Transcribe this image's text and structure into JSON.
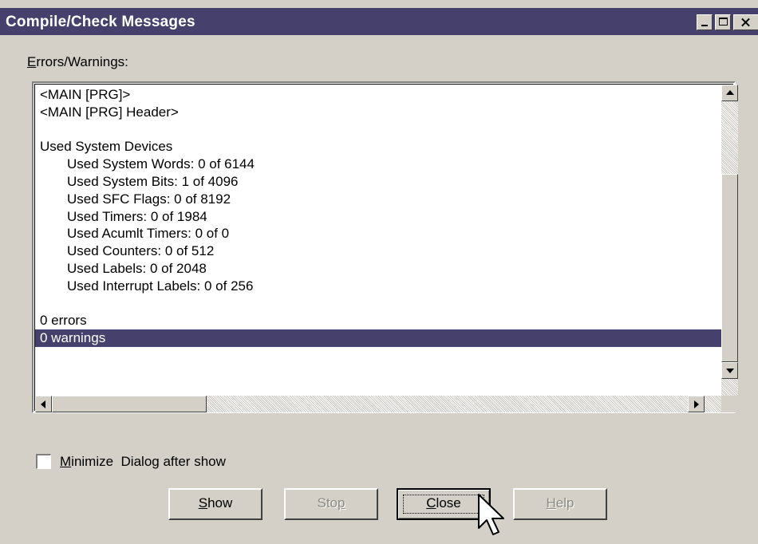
{
  "window": {
    "title": "Compile/Check Messages",
    "title_bar_color": "#46416c",
    "face_color": "#d4d0c8"
  },
  "group": {
    "label_accel": "E",
    "label_rest": "rrors/Warnings:"
  },
  "messages": {
    "lines": [
      "<MAIN [PRG]>",
      "<MAIN [PRG] Header>",
      "",
      "Used System Devices",
      "Used System Words: 0 of 6144",
      "Used System Bits: 1 of 4096",
      "Used SFC Flags: 0 of 8192",
      "Used Timers: 0 of 1984",
      "Used Acumlt Timers: 0 of 0",
      "Used Counters: 0 of 512",
      "Used Labels: 0 of 2048",
      "Used Interrupt Labels: 0 of 256",
      "",
      "0 errors",
      "0 warnings"
    ],
    "selected_line": "0 warnings",
    "selection_color": "#46416c"
  },
  "options": {
    "minimize_accel": "M",
    "minimize_rest": "inimize",
    "minimize_tail": "Dialog after show",
    "minimize_checked": false
  },
  "buttons": {
    "show_accel": "S",
    "show_rest": "how",
    "stop_head": "Sto",
    "stop_accel": "p",
    "close_accel": "C",
    "close_rest": "lose",
    "help_accel": "H",
    "help_rest": "elp"
  },
  "icons": {
    "minimize": "minimize-icon",
    "maximize": "maximize-icon",
    "close": "close-icon",
    "cursor": "arrow-cursor-icon"
  }
}
